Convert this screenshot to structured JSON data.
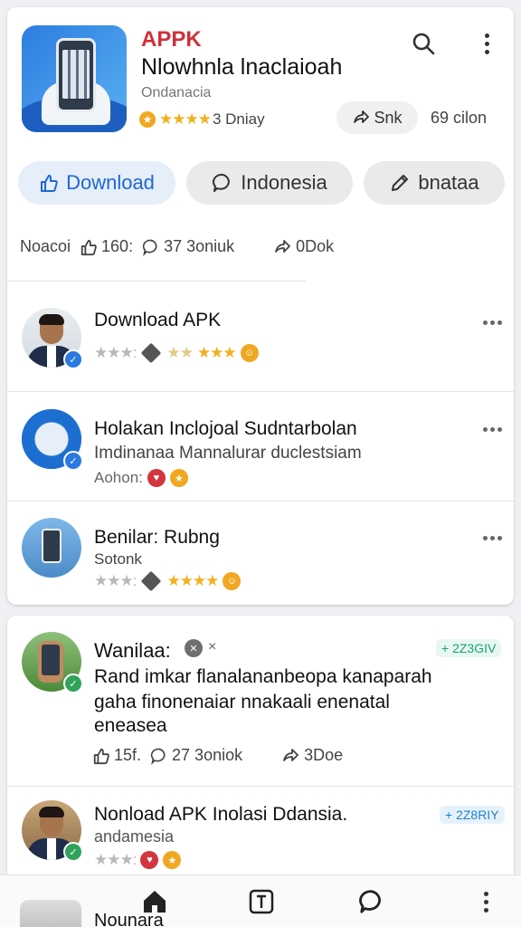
{
  "app": {
    "title_a": "APPK",
    "title_b": "Nlowhnla lnaclaioah",
    "subtitle": "Ondanacia",
    "rating_text": "3 Dniay",
    "share_label": "Snk",
    "size_text": "69 cilon",
    "colors": {
      "accent": "#1f67d8",
      "title_red": "#d0303a",
      "star": "#f2b01e"
    }
  },
  "actions": {
    "download": "Download",
    "indonesia": "Indonesia",
    "share": "bnataa"
  },
  "stats": {
    "label": "Noacoi",
    "likes": "160:",
    "comments": "37 3oniuk",
    "shares": "0Dok"
  },
  "items": [
    {
      "title": "Download APK",
      "sub": "",
      "meta": ""
    },
    {
      "title": "Holakan Inclojoal Sudntarbolan",
      "sub": "Imdinanaa Mannalurar duclestsiam",
      "meta": "Aohon:"
    },
    {
      "title": "Benilar: Rubng",
      "sub": "Sotonk",
      "meta": ""
    }
  ],
  "post": {
    "author": "Wanilaa:",
    "badge": "+ 2Z3GIV",
    "line1": "Rand imkar flanalananbeopa kanaparah",
    "line2": "gaha finonenaiar nnakaali enenatal",
    "line3": "eneasea",
    "likes": "15f.",
    "comments": "27 3oniok",
    "shares": "3Doe"
  },
  "post2": {
    "title": "Nonload APK Inolasi Ddansia.",
    "sub": "andamesia",
    "badge": "+ 2Z8RIY"
  },
  "partial": {
    "label": "Nounara"
  },
  "icons": [
    "search-icon",
    "more-vertical-icon",
    "thumbs-up-icon",
    "comment-icon",
    "share-icon",
    "pencil-icon",
    "home-icon",
    "compose-icon",
    "chat-icon"
  ]
}
